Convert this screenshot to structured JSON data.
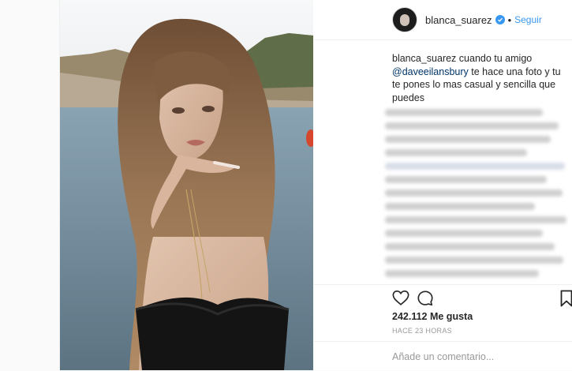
{
  "post": {
    "username": "blanca_suarez",
    "separator": "•",
    "follow_label": "Seguir",
    "caption_user": "blanca_suarez",
    "caption_text_1": "cuando tu amigo",
    "caption_mention": "@daveeilansbury",
    "caption_text_2": "te hace una foto y tu te pones lo mas casual y sencilla que puedes",
    "likes": "242.112 Me gusta",
    "timestamp": "HACE 23 HORAS",
    "comment_placeholder": "Añade un comentario...",
    "icons": {
      "like": "heart-icon",
      "comment": "comment-icon",
      "save": "bookmark-icon",
      "verified": "verified-badge-icon"
    }
  },
  "colors": {
    "link_blue": "#3897f0",
    "mention_blue": "#003569",
    "border": "#efefef",
    "meta_gray": "#999999"
  }
}
